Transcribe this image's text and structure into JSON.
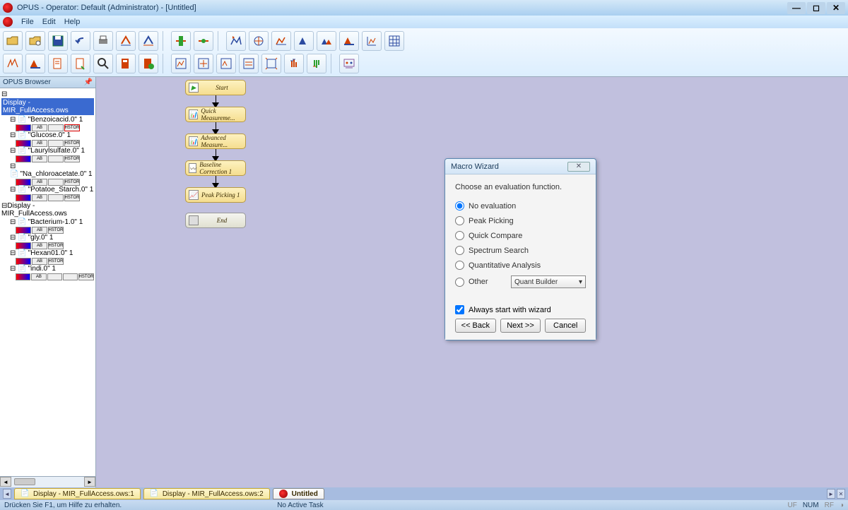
{
  "titlebar": {
    "title": "OPUS - Operator: Default  (Administrator) - [Untitled]"
  },
  "menu": {
    "file": "File",
    "edit": "Edit",
    "help": "Help"
  },
  "sidebar": {
    "title": "OPUS Browser",
    "root1": "Display - MIR_FullAccess.ows",
    "files1": [
      "\"Benzoicacid.0\" 1",
      "\"Glucose.0\" 1",
      "\"Laurylsulfate.0\" 1",
      "\"Na_chloroacetate.0\" 1",
      "\"Potatoe_Starch.0\" 1"
    ],
    "root2": "Display - MIR_FullAccess.ows",
    "files2": [
      "\"Bacterium-1.0\" 1",
      "\"gly.0\" 1",
      "\"Hexan01.0\" 1",
      "\"indi.0\" 1"
    ]
  },
  "flow": {
    "n1": "Start",
    "n2": "Quick Measureme...",
    "n3": "Advanced Measure...",
    "n4": "Baseline Correction 1",
    "n5": "Peak Picking 1",
    "n6": "End"
  },
  "dialog": {
    "title": "Macro Wizard",
    "heading": "Choose an evaluation function.",
    "opts": {
      "none": "No evaluation",
      "peak": "Peak Picking",
      "qc": "Quick Compare",
      "ss": "Spectrum Search",
      "qa": "Quantitative Analysis",
      "other": "Other"
    },
    "dropdown": "Quant Builder",
    "check": "Always start with wizard",
    "back": "<< Back",
    "next": "Next >>",
    "cancel": "Cancel"
  },
  "tabs": {
    "t1": "Display - MIR_FullAccess.ows:1",
    "t2": "Display - MIR_FullAccess.ows:2",
    "t3": "Untitled"
  },
  "status": {
    "left": "Drücken Sie F1, um Hilfe zu erhalten.",
    "mid": "No Active Task",
    "uf": "UF",
    "num": "NUM",
    "rf": "RF"
  }
}
